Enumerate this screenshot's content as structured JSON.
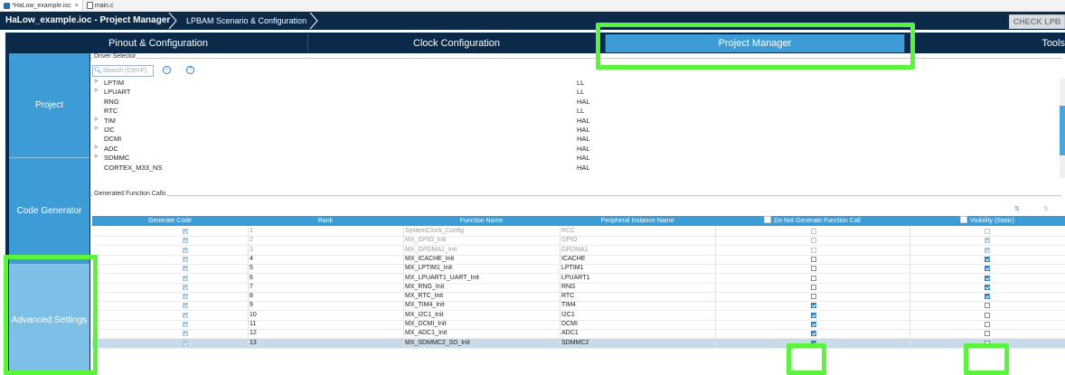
{
  "editor_tabs": [
    {
      "label": "*HaLow_example.ioc",
      "close": "×"
    },
    {
      "label": "main.c"
    }
  ],
  "breadcrumb": {
    "project": "HaLow_example.ioc - Project Manager",
    "scenario": "LPBAM Scenario & Configuration"
  },
  "check_button": "CHECK LPB",
  "main_tabs": [
    "Pinout & Configuration",
    "Clock Configuration",
    "Project Manager",
    "Tools"
  ],
  "left_nav": [
    "Project",
    "Code Generator",
    "Advanced Settings"
  ],
  "driver_selector": {
    "title": "Driver Selector",
    "search_placeholder": "Search (Ctrl+F)",
    "rows": [
      {
        "expand": ">",
        "name": "LPTIM",
        "driver": "LL"
      },
      {
        "expand": ">",
        "name": "LPUART",
        "driver": "LL"
      },
      {
        "expand": "",
        "name": "RNG",
        "driver": "HAL"
      },
      {
        "expand": "",
        "name": "RTC",
        "driver": "LL"
      },
      {
        "expand": ">",
        "name": "TIM",
        "driver": "HAL"
      },
      {
        "expand": ">",
        "name": "I2C",
        "driver": "HAL"
      },
      {
        "expand": "",
        "name": "DCMI",
        "driver": "HAL"
      },
      {
        "expand": ">",
        "name": "ADC",
        "driver": "HAL"
      },
      {
        "expand": ">",
        "name": "SDMMC",
        "driver": "HAL"
      },
      {
        "expand": "",
        "name": "CORTEX_M33_NS",
        "driver": "HAL"
      }
    ]
  },
  "function_calls": {
    "title": "Generated Function Calls",
    "sort_icons": [
      "⇅",
      "⇅"
    ],
    "headers": [
      "Generate Code",
      "Rank",
      "Function Name",
      "Peripheral Instance Name",
      "Do Not Generate Function Call",
      "Visibility (Static)"
    ],
    "rows": [
      {
        "rank": "1",
        "func": "SystemClock_Config",
        "inst": "RCC",
        "gen": true,
        "nogen": false,
        "vis": false,
        "disabled": true
      },
      {
        "rank": "2",
        "func": "MX_GPIO_Init",
        "inst": "GPIO",
        "gen": true,
        "nogen": false,
        "vis": true,
        "disabled": true
      },
      {
        "rank": "3",
        "func": "MX_GPDMA1_Init",
        "inst": "GPDMA1",
        "gen": true,
        "nogen": false,
        "vis": true,
        "disabled": true
      },
      {
        "rank": "4",
        "func": "MX_ICACHE_Init",
        "inst": "ICACHE",
        "gen": true,
        "nogen": false,
        "vis": true,
        "disabled": false
      },
      {
        "rank": "5",
        "func": "MX_LPTIM1_Init",
        "inst": "LPTIM1",
        "gen": true,
        "nogen": false,
        "vis": true,
        "disabled": false
      },
      {
        "rank": "6",
        "func": "MX_LPUART1_UART_Init",
        "inst": "LPUART1",
        "gen": true,
        "nogen": false,
        "vis": true,
        "disabled": false
      },
      {
        "rank": "7",
        "func": "MX_RNG_Init",
        "inst": "RNG",
        "gen": true,
        "nogen": false,
        "vis": true,
        "disabled": false
      },
      {
        "rank": "8",
        "func": "MX_RTC_Init",
        "inst": "RTC",
        "gen": true,
        "nogen": false,
        "vis": true,
        "disabled": false
      },
      {
        "rank": "9",
        "func": "MX_TIM4_Init",
        "inst": "TIM4",
        "gen": true,
        "nogen": true,
        "vis": false,
        "disabled": false
      },
      {
        "rank": "10",
        "func": "MX_I2C1_Init",
        "inst": "I2C1",
        "gen": true,
        "nogen": true,
        "vis": false,
        "disabled": false
      },
      {
        "rank": "11",
        "func": "MX_DCMI_Init",
        "inst": "DCMI",
        "gen": true,
        "nogen": true,
        "vis": false,
        "disabled": false
      },
      {
        "rank": "12",
        "func": "MX_ADC1_Init",
        "inst": "ADC1",
        "gen": true,
        "nogen": true,
        "vis": false,
        "disabled": false
      },
      {
        "rank": "13",
        "func": "MX_SDMMC2_SD_Init",
        "inst": "SDMMC2",
        "gen": true,
        "nogen": true,
        "vis": false,
        "disabled": false,
        "selected": true
      }
    ]
  },
  "colors": {
    "header_navy": "#0b2a4a",
    "tab_active": "#3d9bd6",
    "highlight": "#5bf43c",
    "selected_row": "#c9dbe9"
  }
}
